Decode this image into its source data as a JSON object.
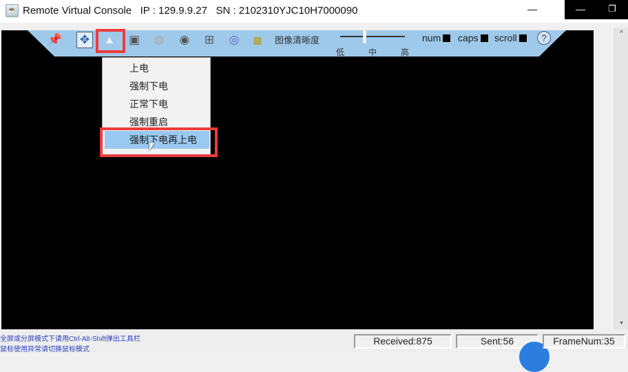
{
  "window": {
    "title": "Remote Virtual Console   IP : 129.9.9.27   SN : 2102310YJC10H7000090"
  },
  "toolbar": {
    "icons": [
      "pin-icon",
      "move-icon",
      "power-icon",
      "capture-icon",
      "mouse-icon",
      "cd-drive-icon",
      "floppy-icon",
      "disc-icon",
      "keyboard-icon"
    ],
    "image_quality_label": "图像清晰度",
    "slider": {
      "ticks": [
        "低",
        "中",
        "高"
      ],
      "value": "中"
    },
    "num_label": "num",
    "caps_label": "caps",
    "scroll_label": "scroll",
    "help_label": "?"
  },
  "power_menu": {
    "items": [
      "上电",
      "强制下电",
      "正常下电",
      "强制重启",
      "强制下电再上电"
    ],
    "selected": "强制下电再上电"
  },
  "status": {
    "hint1": "全屏或分屏模式下请用Ctrl-Alt-Shift弹出工具栏",
    "hint2": "鼠标使用异常请切换鼠标模式",
    "received": "Received:875",
    "sent": "Sent:56",
    "framenum": "FrameNum:35"
  },
  "colors": {
    "toolbar": "#9ec9ea",
    "highlight": "#ef3c3c",
    "menu_selected": "#99c9f1"
  }
}
